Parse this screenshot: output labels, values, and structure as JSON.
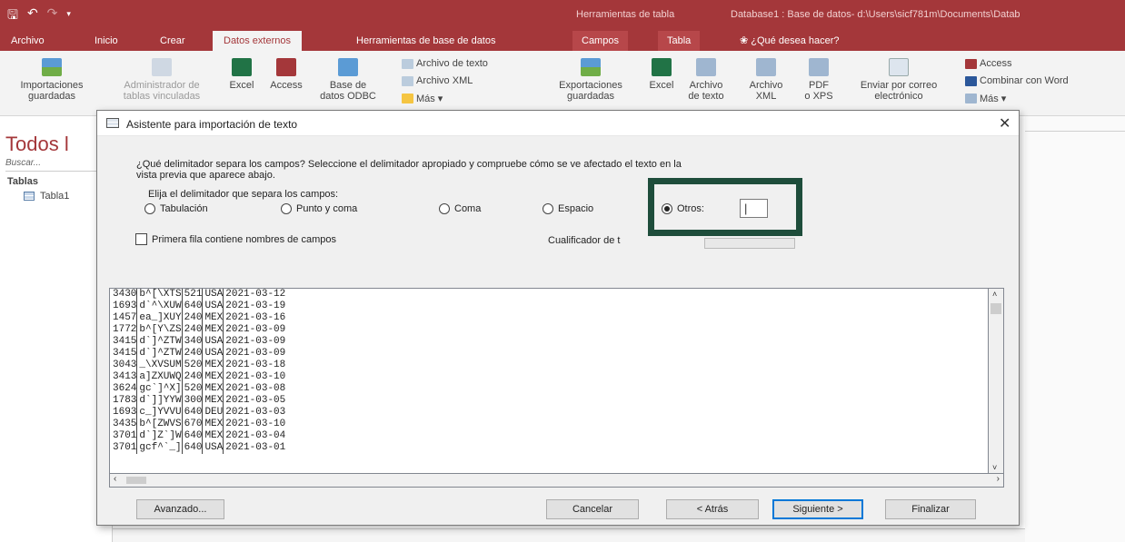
{
  "app": {
    "title_ctx": "Herramientas de tabla",
    "title_db": "Database1 : Base de datos- d:\\Users\\sicf781m\\Documents\\Datab"
  },
  "tabs": {
    "archivo": "Archivo",
    "inicio": "Inicio",
    "crear": "Crear",
    "datos_externos": "Datos externos",
    "herramientas_bd": "Herramientas de base de datos",
    "campos": "Campos",
    "tabla": "Tabla",
    "tell_me": "¿Qué desea hacer?"
  },
  "ribbon": {
    "importaciones_1": "Importaciones",
    "importaciones_2": "guardadas",
    "administrador_1": "Administrador de",
    "administrador_2": "tablas vinculadas",
    "excel": "Excel",
    "access": "Access",
    "odbc_1": "Base de",
    "odbc_2": "datos ODBC",
    "archivo_texto": "Archivo de texto",
    "archivo_xml": "Archivo XML",
    "mas": "Más",
    "exportaciones_1": "Exportaciones",
    "exportaciones_2": "guardadas",
    "excel2": "Excel",
    "archivo_texto2_1": "Archivo",
    "archivo_texto2_2": "de texto",
    "archivo_xml2_1": "Archivo",
    "archivo_xml2_2": "XML",
    "pdf_1": "PDF",
    "pdf_2": "o XPS",
    "correo_1": "Enviar por correo",
    "correo_2": "electrónico",
    "access2": "Access",
    "combinar": "Combinar con Word",
    "mas2": "Más"
  },
  "nav": {
    "heading": "Todos l",
    "search": "Buscar...",
    "group": "Tablas",
    "item": "Tabla1"
  },
  "dialog": {
    "title": "Asistente para importación de texto",
    "prompt_1": "¿Qué delimitador separa los campos? Seleccione el delimitador apropiado y compruebe cómo se ve afectado el texto en la",
    "prompt_2": "vista previa que aparece abajo.",
    "group_label": "Elija el delimitador que separa los campos:",
    "opt_tab": "Tabulación",
    "opt_punto": "Punto y coma",
    "opt_coma": "Coma",
    "opt_espacio": "Espacio",
    "opt_otros": "Otros:",
    "otros_value": "|",
    "first_row": "Primera fila contiene nombres de campos",
    "qualifier": "Cualificador de t",
    "btn_avanzado": "Avanzado...",
    "btn_cancelar": "Cancelar",
    "btn_atras": "< Atrás",
    "btn_siguiente": "Siguiente >",
    "btn_finalizar": "Finalizar"
  },
  "preview": [
    [
      "3430",
      "b^[\\XTS",
      "521",
      "USA",
      "2021-03-12"
    ],
    [
      "1693",
      "d`^\\XUW",
      "640",
      "USA",
      "2021-03-19"
    ],
    [
      "1457",
      "ea_]XUY",
      "240",
      "MEX",
      "2021-03-16"
    ],
    [
      "1772",
      "b^[Y\\ZS",
      "240",
      "MEX",
      "2021-03-09"
    ],
    [
      "3415",
      "d`]^ZTW",
      "340",
      "USA",
      "2021-03-09"
    ],
    [
      "3415",
      "d`]^ZTW",
      "240",
      "USA",
      "2021-03-09"
    ],
    [
      "3043",
      "_\\XVSUM",
      "520",
      "MEX",
      "2021-03-18"
    ],
    [
      "3413",
      "a]ZXUWQ",
      "240",
      "MEX",
      "2021-03-10"
    ],
    [
      "3624",
      "gc`]^X]",
      "520",
      "MEX",
      "2021-03-08"
    ],
    [
      "1783",
      "d`]]YYW",
      "300",
      "MEX",
      "2021-03-05"
    ],
    [
      "1693",
      "c_]YVVU",
      "640",
      "DEU",
      "2021-03-03"
    ],
    [
      "3435",
      "b^[ZWVS",
      "670",
      "MEX",
      "2021-03-10"
    ],
    [
      "3701",
      "d`]Z`]W",
      "640",
      "MEX",
      "2021-03-04"
    ],
    [
      "3701",
      "gcf^`_]",
      "640",
      "USA",
      "2021-03-01"
    ]
  ],
  "colors": {
    "access_red": "#a4373a",
    "highlight_box": "#1e4d3b"
  }
}
